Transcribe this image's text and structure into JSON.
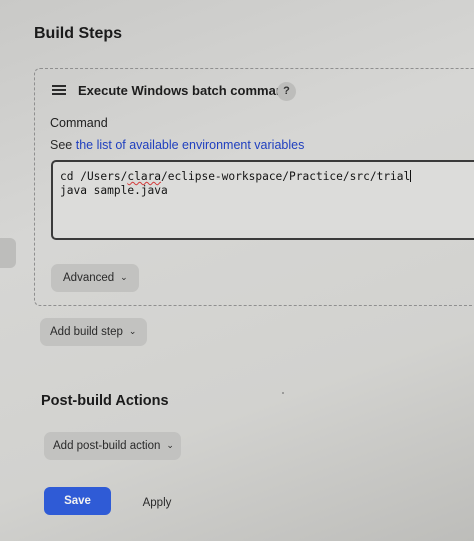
{
  "build_steps": {
    "title": "Build Steps",
    "step": {
      "title": "Execute Windows batch command",
      "help_icon_text": "?",
      "command_label": "Command",
      "see_prefix": "See",
      "env_vars_link": "the list of available environment variables",
      "command_lines": [
        "cd /Users/clara/eclipse-workspace/Practice/src/trial",
        "java sample.java"
      ],
      "advanced_label": "Advanced"
    },
    "add_step_label": "Add build step"
  },
  "post_build": {
    "title": "Post-build Actions",
    "add_action_label": "Add post-build action"
  },
  "footer": {
    "save_label": "Save",
    "apply_label": "Apply"
  },
  "icons": {
    "drag_handle": "hamburger-icon",
    "help": "question-icon",
    "chevron": "chevron-down-icon"
  },
  "colors": {
    "primary_button": "#2f5bd6",
    "link": "#1f3fbf",
    "spellcheck_underline": "#d23a3a"
  }
}
